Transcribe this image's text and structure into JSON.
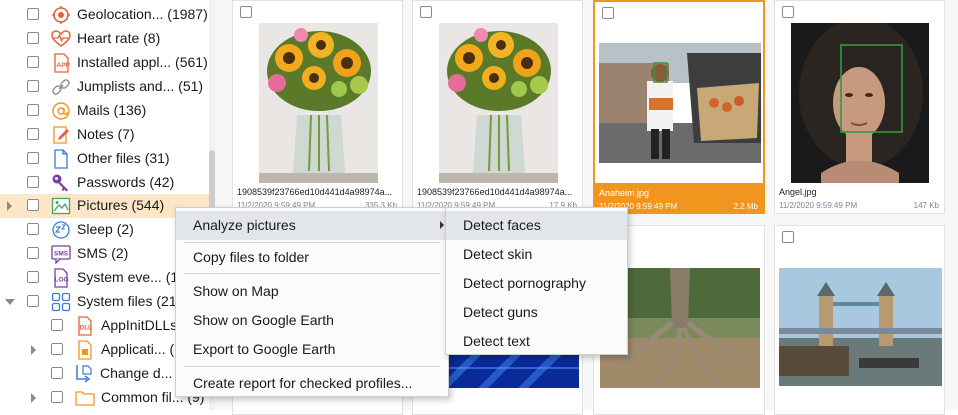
{
  "sidebar": {
    "items": [
      {
        "label": "Geolocation... (1987)",
        "icon": "geolocation-icon"
      },
      {
        "label": "Heart rate (8)",
        "icon": "heart-rate-icon"
      },
      {
        "label": "Installed appl... (561)",
        "icon": "installed-apps-icon"
      },
      {
        "label": "Jumplists and... (51)",
        "icon": "jumplists-icon"
      },
      {
        "label": "Mails (136)",
        "icon": "mail-icon"
      },
      {
        "label": "Notes (7)",
        "icon": "notes-icon"
      },
      {
        "label": "Other files (31)",
        "icon": "other-files-icon"
      },
      {
        "label": "Passwords (42)",
        "icon": "passwords-icon"
      },
      {
        "label": "Pictures (544)",
        "icon": "pictures-icon"
      },
      {
        "label": "Sleep (2)",
        "icon": "sleep-icon"
      },
      {
        "label": "SMS (2)",
        "icon": "sms-icon"
      },
      {
        "label": "System eve... (1",
        "icon": "system-events-icon"
      },
      {
        "label": "System files (210",
        "icon": "system-files-icon"
      },
      {
        "label": "AppInitDLLs",
        "icon": "dll-icon"
      },
      {
        "label": "Applicati... (",
        "icon": "application-icon"
      },
      {
        "label": "Change d...",
        "icon": "change-icon"
      },
      {
        "label": "Common fil... (9)",
        "icon": "folder-icon"
      }
    ]
  },
  "gallery": {
    "tiles": [
      {
        "name": "1908539f23766ed10d441d4a98974a...",
        "date": "11/2/2020 9:59:49 PM",
        "size": "335.3 Kb"
      },
      {
        "name": "1908539f23766ed10d441d4a98974a...",
        "date": "11/2/2020 9:59:49 PM",
        "size": "17.9 Kb"
      },
      {
        "name": "Anaheim.jpg",
        "date": "11/2/2020 9:59:49 PM",
        "size": "2.2 Mb"
      },
      {
        "name": "Angel.jpg",
        "date": "11/2/2020 9:59:49 PM",
        "size": "147 Kb"
      }
    ]
  },
  "context_menu": {
    "items": [
      {
        "label": "Analyze pictures"
      },
      {
        "label": "Copy files to folder"
      },
      {
        "label": "Show on Map"
      },
      {
        "label": "Show on Google Earth"
      },
      {
        "label": "Export to Google Earth"
      },
      {
        "label": "Create report for checked profiles..."
      }
    ],
    "submenu": [
      {
        "label": "Detect faces"
      },
      {
        "label": "Detect skin"
      },
      {
        "label": "Detect pornography"
      },
      {
        "label": "Detect guns"
      },
      {
        "label": "Detect text"
      }
    ]
  },
  "colors": {
    "accent": "#f0961e",
    "selection_row": "#fbe7c8",
    "face_box": "#2e9b3d",
    "meta_text": "#7a869a"
  }
}
